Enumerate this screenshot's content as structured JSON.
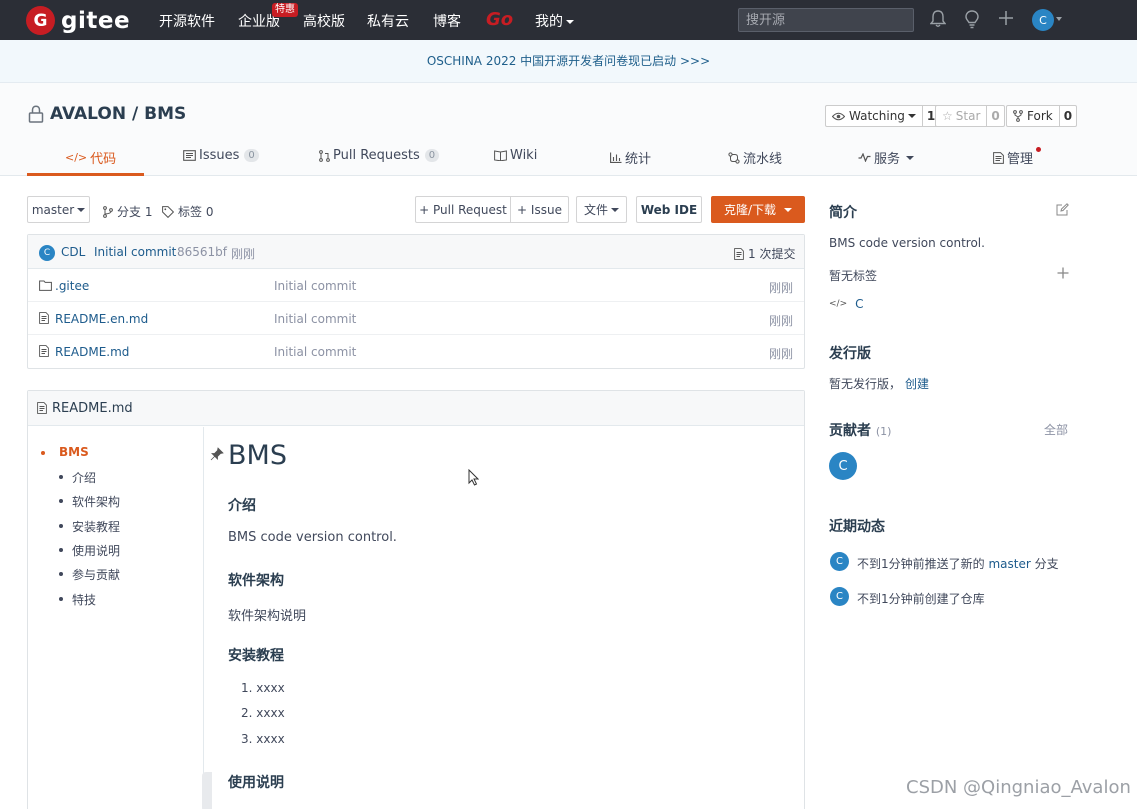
{
  "nav": {
    "logo_letter": "G",
    "logo_text": "gitee",
    "items": [
      "开源软件",
      "企业版",
      "高校版",
      "私有云",
      "博客"
    ],
    "go": "Go",
    "mine": "我的",
    "enterprise_badge": "特惠",
    "search_placeholder": "搜开源",
    "avatar_letter": "C"
  },
  "banner": "OSCHINA 2022 中国开源开发者问卷现已启动 >>>",
  "repo": {
    "owner": "AVALON",
    "separator": " / ",
    "name": "BMS",
    "watching_label": "Watching",
    "watching_count": "1",
    "star_label": "Star",
    "star_count": "0",
    "fork_label": "Fork",
    "fork_count": "0"
  },
  "tabs": {
    "code": "代码",
    "issues": "Issues",
    "issues_count": "0",
    "pull_requests": "Pull Requests",
    "pr_count": "0",
    "wiki": "Wiki",
    "stats": "统计",
    "pipeline": "流水线",
    "services": "服务",
    "manage": "管理"
  },
  "toolbar": {
    "branch": "master",
    "branches": "分支 1",
    "tags": "标签 0",
    "pull_request": "+ Pull Request",
    "issue": "+ Issue",
    "file": "文件",
    "web_ide": "Web IDE",
    "clone": "克隆/下载"
  },
  "commit": {
    "avatar": "C",
    "author": "CDL",
    "message": "Initial commit",
    "hash": "86561bf",
    "time": "刚刚",
    "count": "1 次提交"
  },
  "files": [
    {
      "name": ".gitee",
      "type": "folder",
      "message": "Initial commit",
      "time": "刚刚"
    },
    {
      "name": "README.en.md",
      "type": "file",
      "message": "Initial commit",
      "time": "刚刚"
    },
    {
      "name": "README.md",
      "type": "file",
      "message": "Initial commit",
      "time": "刚刚"
    }
  ],
  "readme": {
    "filename": "README.md",
    "toc": [
      "BMS",
      "介绍",
      "软件架构",
      "安装教程",
      "使用说明",
      "参与贡献",
      "特技"
    ],
    "title": "BMS",
    "intro_h": "介绍",
    "intro_p": "BMS code version control.",
    "arch_h": "软件架构",
    "arch_p": "软件架构说明",
    "install_h": "安装教程",
    "install_items": [
      "1. xxxx",
      "2. xxxx",
      "3. xxxx"
    ],
    "usage_h": "使用说明"
  },
  "sidebar": {
    "intro_h": "简介",
    "desc": "BMS code version control.",
    "no_tags": "暂无标签",
    "language": "C",
    "releases_h": "发行版",
    "no_releases": "暂无发行版，",
    "create": "创建",
    "contributors_h": "贡献者",
    "contributors_count": "(1)",
    "all": "全部",
    "contributor_avatar": "C",
    "activity_h": "近期动态",
    "activity": [
      {
        "avatar": "C",
        "text": "不到1分钟前推送了新的 ",
        "link": "master",
        "suffix": " 分支"
      },
      {
        "avatar": "C",
        "text": "不到1分钟前创建了仓库",
        "link": "",
        "suffix": ""
      }
    ]
  },
  "watermark": "CSDN @Qingniao_Avalon"
}
